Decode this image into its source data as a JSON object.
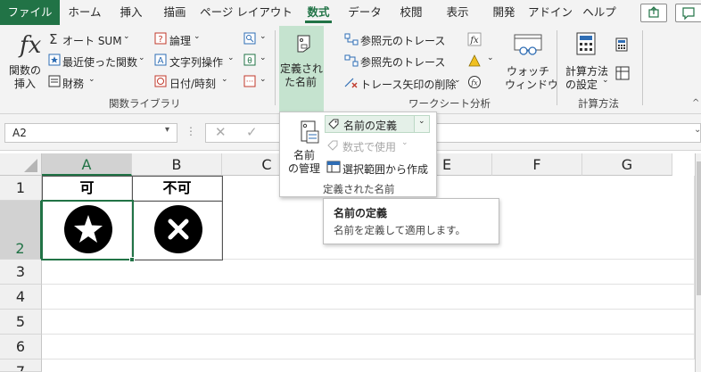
{
  "tabs": [
    "ファイル",
    "ホーム",
    "挿入",
    "描画",
    "ページ レイアウト",
    "数式",
    "データ",
    "校閲",
    "表示",
    "開発",
    "アドイン",
    "ヘルプ"
  ],
  "active_tab": "数式",
  "ribbon": {
    "function_library": {
      "insert_function": [
        "関数の",
        "挿入"
      ],
      "autosum": "オート SUM",
      "recent": "最近使った関数",
      "financial": "財務",
      "logical": "論理",
      "text": "文字列操作",
      "datetime": "日付/時刻",
      "label": "関数ライブラリ"
    },
    "defined_names": {
      "define_name_button": [
        "定義され",
        "た名前"
      ]
    },
    "formula_auditing": {
      "trace_precedents": "参照元のトレース",
      "trace_dependents": "参照先のトレース",
      "remove_arrows": "トレース矢印の削除",
      "watch_window": [
        "ウォッチ",
        "ウィンドウ"
      ],
      "label": "ワークシート分析"
    },
    "calculation": {
      "options": [
        "計算方法",
        "の設定"
      ],
      "label": "計算方法"
    }
  },
  "formula_bar": {
    "name_box": "A2"
  },
  "dropdown": {
    "name_manager": [
      "名前",
      "の管理"
    ],
    "define_name": "名前の定義",
    "use_in_formula": "数式で使用",
    "create_from_selection": "選択範囲から作成",
    "label": "定義された名前"
  },
  "tooltip": {
    "title": "名前の定義",
    "description": "名前を定義して適用します。"
  },
  "sheet": {
    "columns": [
      "A",
      "B",
      "C",
      "D",
      "E",
      "F",
      "G"
    ],
    "rows": [
      "1",
      "2",
      "3",
      "4",
      "5",
      "6",
      "7"
    ],
    "cells": {
      "A1": "可",
      "B1": "不可"
    },
    "icons": {
      "A2": "star-circle-icon",
      "B2": "x-circle-icon"
    }
  },
  "colors": {
    "accent": "#217346",
    "selected_button": "#c5e3cf",
    "ribbon": "#f3f3f3",
    "icon_fill": "#000000"
  }
}
